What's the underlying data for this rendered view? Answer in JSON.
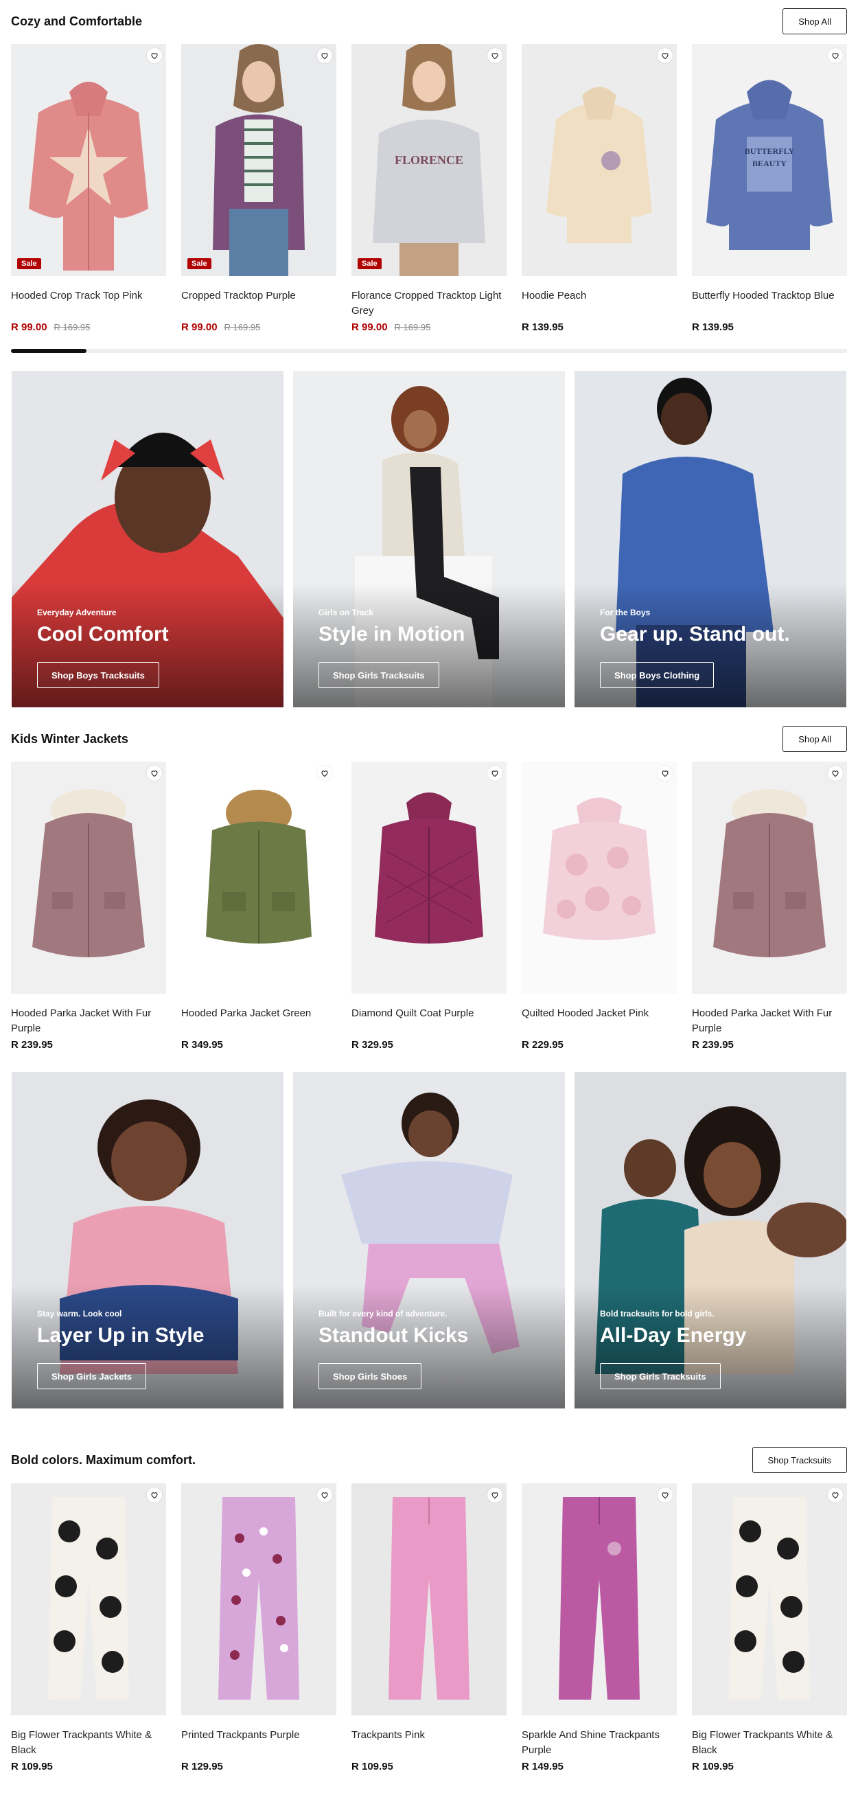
{
  "section1": {
    "title": "Cozy and Comfortable",
    "action": "Shop All",
    "products": [
      {
        "name": "Hooded Crop Track Top Pink",
        "price": "R 99.00",
        "was": "R 169.95",
        "badge": "Sale",
        "image": "pink-star-hoodie"
      },
      {
        "name": "Cropped Tracktop Purple",
        "price": "R 99.00",
        "was": "R 169.95",
        "badge": "Sale",
        "image": "girl-purple-tracktop"
      },
      {
        "name": "Florance Cropped Tracktop Light Grey",
        "price": "R 99.00",
        "was": "R 169.95",
        "badge": "Sale",
        "image": "girl-grey-tracktop"
      },
      {
        "name": "Hoodie Peach",
        "price": "R 139.95",
        "image": "peach-hoodie"
      },
      {
        "name": "Butterfly Hooded Tracktop Blue",
        "price": "R 139.95",
        "image": "blue-butterfly-hoodie"
      }
    ],
    "scroll_progress": 0.09
  },
  "banners1": [
    {
      "eyebrow": "Everyday Adventure",
      "headline": "Cool Comfort",
      "cta": "Shop Boys Tracksuits",
      "image": "boy-red-hoodie"
    },
    {
      "eyebrow": "Girls on Track",
      "headline": "Style in Motion",
      "cta": "Shop Girls Tracksuits",
      "image": "girl-black-tracksuit"
    },
    {
      "eyebrow": "For the Boys",
      "headline": "Gear up. Stand out.",
      "cta": "Shop Boys Clothing",
      "image": "boy-blue-hoodie"
    }
  ],
  "section2": {
    "title": "Kids Winter Jackets",
    "action": "Shop All",
    "products": [
      {
        "name": "Hooded Parka Jacket With Fur Purple",
        "price": "R 239.95",
        "image": "mauve-parka"
      },
      {
        "name": "Hooded Parka Jacket Green",
        "price": "R 349.95",
        "image": "green-parka"
      },
      {
        "name": "Diamond Quilt Coat Purple",
        "price": "R 329.95",
        "image": "plum-quilt-coat"
      },
      {
        "name": "Quilted Hooded Jacket Pink",
        "price": "R 229.95",
        "image": "pink-quilted-jacket"
      },
      {
        "name": "Hooded Parka Jacket With Fur Purple",
        "price": "R 239.95",
        "image": "mauve-parka"
      }
    ]
  },
  "banners2": [
    {
      "eyebrow": "Stay warm. Look cool",
      "headline": "Layer Up in Style",
      "cta": "Shop Girls Jackets",
      "image": "girl-pink-jacket"
    },
    {
      "eyebrow": "Built for every kind of adventure.",
      "headline": "Standout Kicks",
      "cta": "Shop Girls Shoes",
      "image": "girl-jumping"
    },
    {
      "eyebrow": "Bold tracksuits for bold girls.",
      "headline": "All-Day Energy",
      "cta": "Shop Girls Tracksuits",
      "image": "two-girls"
    }
  ],
  "section3": {
    "title": "Bold colors. Maximum comfort.",
    "action": "Shop Tracksuits",
    "products": [
      {
        "name": "Big Flower Trackpants White & Black",
        "price": "R 109.95",
        "image": "flower-trackpants"
      },
      {
        "name": "Printed Trackpants Purple",
        "price": "R 129.95",
        "image": "printed-trackpants"
      },
      {
        "name": "Trackpants Pink",
        "price": "R 109.95",
        "image": "pink-trackpants"
      },
      {
        "name": "Sparkle And Shine Trackpants Purple",
        "price": "R 149.95",
        "image": "sparkle-trackpants"
      },
      {
        "name": "Big Flower Trackpants White & Black",
        "price": "R 109.95",
        "image": "flower-trackpants"
      }
    ]
  },
  "colors": {
    "sale": "#b00000",
    "text": "#111111",
    "muted": "#888888",
    "banner_text": "#ffffff"
  },
  "icons": {
    "wishlist": "heart-icon"
  }
}
